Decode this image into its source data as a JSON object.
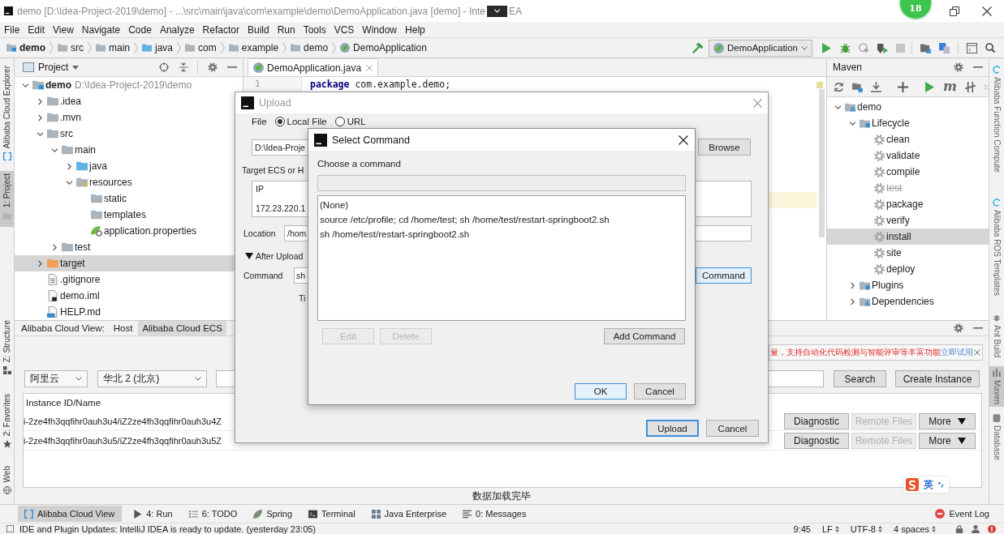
{
  "window": {
    "title": "demo [D:\\Idea-Project-2019\\demo] - ...\\src\\main\\java\\com\\example\\demo\\DemoApplication.java [demo] - Inte",
    "overlay_expanded": false,
    "title_tail": "EA",
    "floating_badge": "18"
  },
  "menu": [
    "File",
    "Edit",
    "View",
    "Navigate",
    "Code",
    "Analyze",
    "Refactor",
    "Build",
    "Run",
    "Tools",
    "VCS",
    "Window",
    "Help"
  ],
  "breadcrumbs": [
    {
      "label": "demo",
      "kind": "module"
    },
    {
      "label": "src",
      "kind": "folder"
    },
    {
      "label": "main",
      "kind": "folder"
    },
    {
      "label": "java",
      "kind": "source"
    },
    {
      "label": "com",
      "kind": "package"
    },
    {
      "label": "example",
      "kind": "package"
    },
    {
      "label": "demo",
      "kind": "package"
    },
    {
      "label": "DemoApplication",
      "kind": "spring"
    }
  ],
  "run_configuration": "DemoApplication",
  "left_strip": [
    {
      "label": "Alibaba Cloud Explorer",
      "kind": "cloud",
      "selected": false
    },
    {
      "label": "1: Project",
      "kind": "folder",
      "selected": true
    },
    {
      "label": "Z: Structure",
      "kind": "structure",
      "selected": false
    },
    {
      "label": "2: Favorites",
      "kind": "star",
      "selected": false
    },
    {
      "label": "Web",
      "kind": "globe",
      "selected": false
    }
  ],
  "project_panel": {
    "title": "Project",
    "tree": [
      {
        "name": "demo",
        "path": "D:\\Idea-Project-2019\\demo",
        "kind": "module",
        "expanded": true,
        "selected": false,
        "children": [
          {
            "name": ".idea",
            "kind": "folder",
            "expanded": false,
            "selected": false
          },
          {
            "name": ".mvn",
            "kind": "folder",
            "expanded": false,
            "selected": false
          },
          {
            "name": "src",
            "kind": "folder",
            "expanded": true,
            "selected": false,
            "children": [
              {
                "name": "main",
                "kind": "folder",
                "expanded": true,
                "selected": false,
                "children": [
                  {
                    "name": "java",
                    "kind": "source",
                    "expanded": false,
                    "selected": false
                  },
                  {
                    "name": "resources",
                    "kind": "resources",
                    "expanded": true,
                    "selected": false,
                    "children": [
                      {
                        "name": "static",
                        "kind": "folder",
                        "selected": false
                      },
                      {
                        "name": "templates",
                        "kind": "folder",
                        "selected": false
                      },
                      {
                        "name": "application.properties",
                        "kind": "properties",
                        "selected": false
                      }
                    ]
                  }
                ]
              },
              {
                "name": "test",
                "kind": "folder",
                "expanded": false,
                "selected": false
              }
            ]
          },
          {
            "name": "target",
            "kind": "excluded",
            "expanded": false,
            "selected": true
          },
          {
            "name": ".gitignore",
            "kind": "text",
            "selected": false
          },
          {
            "name": "demo.iml",
            "kind": "iml",
            "selected": false
          },
          {
            "name": "HELP.md",
            "kind": "markdown",
            "selected": false
          }
        ]
      }
    ]
  },
  "editor": {
    "tabs": [
      {
        "label": "DemoApplication.java",
        "selected": true
      }
    ],
    "lines": [
      {
        "number": "1",
        "code": "**package** com.example.demo;"
      }
    ]
  },
  "maven": {
    "title": "Maven",
    "goal_button": "m",
    "tree": [
      {
        "name": "demo",
        "kind": "project",
        "expanded": true,
        "selected": false,
        "children": [
          {
            "name": "Lifecycle",
            "kind": "lifecycle",
            "expanded": true,
            "selected": false,
            "children": [
              {
                "name": "clean",
                "kind": "goal",
                "skipped": false,
                "selected": false
              },
              {
                "name": "validate",
                "kind": "goal",
                "skipped": false,
                "selected": false
              },
              {
                "name": "compile",
                "kind": "goal",
                "skipped": false,
                "selected": false
              },
              {
                "name": "test",
                "kind": "goal",
                "skipped": true,
                "selected": false
              },
              {
                "name": "package",
                "kind": "goal",
                "skipped": false,
                "selected": false
              },
              {
                "name": "verify",
                "kind": "goal",
                "skipped": false,
                "selected": false
              },
              {
                "name": "install",
                "kind": "goal",
                "skipped": false,
                "selected": true
              },
              {
                "name": "site",
                "kind": "goal",
                "skipped": false,
                "selected": false
              },
              {
                "name": "deploy",
                "kind": "goal",
                "skipped": false,
                "selected": false
              }
            ]
          },
          {
            "name": "Plugins",
            "kind": "plugins",
            "expanded": false,
            "selected": false
          },
          {
            "name": "Dependencies",
            "kind": "dependencies",
            "expanded": false,
            "selected": false
          }
        ]
      }
    ]
  },
  "right_strip": [
    {
      "label": "Alibaba Function Compute",
      "kind": "function",
      "selected": false
    },
    {
      "label": "Alibaba ROS Templates",
      "kind": "ros",
      "selected": false
    },
    {
      "label": "Ant Build",
      "kind": "ant",
      "selected": false
    },
    {
      "label": "Maven",
      "kind": "maven",
      "selected": true
    },
    {
      "label": "Database",
      "kind": "database",
      "selected": false
    }
  ],
  "bottom_panel": {
    "label": "Alibaba Cloud View:",
    "tabs": [
      {
        "label": "Host",
        "selected": false
      },
      {
        "label": "Alibaba Cloud ECS",
        "selected": true
      }
    ],
    "notice": {
      "text": "量，支持自动化代码检测与智能评审等丰富功能",
      "link": "立即试用"
    },
    "account": "阿里云",
    "region": "华北 2 (北京)",
    "search_button": "Search",
    "create_button": "Create Instance",
    "table": {
      "columns": [
        "Instance ID/Name"
      ],
      "rows": [
        {
          "name": "i-2ze4fh3qqfihr0auh3u4/iZ2ze4fh3qqfihr0auh3u4Z",
          "actions": [
            {
              "label": "Diagnostic",
              "disabled": false
            },
            {
              "label": "Remote Files",
              "disabled": true
            },
            {
              "label": "More",
              "disabled": false
            }
          ]
        },
        {
          "name": "i-2ze4fh3qqfihr0auh3u5/iZ2ze4fh3qqfihr0auh3u5Z",
          "actions": [
            {
              "label": "Diagnostic",
              "disabled": false
            },
            {
              "label": "Remote Files",
              "disabled": true
            },
            {
              "label": "More",
              "disabled": false
            }
          ]
        }
      ]
    },
    "status": "数据加载完毕"
  },
  "tool_windows": [
    {
      "label": "Alibaba Cloud View",
      "kind": "cloud",
      "selected": true
    },
    {
      "label": "4: Run",
      "kind": "run",
      "selected": false
    },
    {
      "label": "6: TODO",
      "kind": "todo",
      "selected": false
    },
    {
      "label": "Spring",
      "kind": "leaf",
      "selected": false
    },
    {
      "label": "Terminal",
      "kind": "terminal",
      "selected": false
    },
    {
      "label": "Java Enterprise",
      "kind": "enterprise",
      "selected": false
    },
    {
      "label": "0: Messages",
      "kind": "messages",
      "selected": false
    }
  ],
  "event_log": "Event Log",
  "status_bar": {
    "message": "IDE and Plugin Updates: IntelliJ IDEA is ready to update. (yesterday 23:05)",
    "position": "9:45",
    "line_separator": "LF",
    "encoding": "UTF-8",
    "indent": "4 spaces"
  },
  "upload_dialog": {
    "title": "Upload",
    "file_label": "File",
    "sources": [
      {
        "label": "Local File",
        "selected": true
      },
      {
        "label": "URL",
        "selected": false
      }
    ],
    "file_path": "D:\\Idea-Proje",
    "browse_button": "Browse",
    "target_label": "Target ECS or H",
    "target_table": {
      "column": "IP",
      "row": "172.23.220.1"
    },
    "location_label": "Location",
    "location": "/hom",
    "after_upload": {
      "label": "After Upload",
      "expanded": true
    },
    "command_label": "Command",
    "command": "sh",
    "command_button": {
      "label": "Command",
      "focused": true
    },
    "tip": "Ti",
    "buttons": [
      {
        "label": "Upload",
        "default": true
      },
      {
        "label": "Cancel",
        "default": false
      }
    ]
  },
  "select_command_dialog": {
    "title": "Select Command",
    "prompt": "Choose a command",
    "commands": [
      {
        "text": "(None)",
        "selected": false
      },
      {
        "text": "source /etc/profile; cd /home/test; sh /home/test/restart-springboot2.sh",
        "selected": false
      },
      {
        "text": "sh /home/test/restart-springboot2.sh",
        "selected": false
      }
    ],
    "buttons": [
      {
        "label": "Edit",
        "disabled": true
      },
      {
        "label": "Delete",
        "disabled": true
      },
      {
        "label": "Add Command",
        "disabled": false
      }
    ],
    "footer_buttons": [
      {
        "label": "OK",
        "default": true
      },
      {
        "label": "Cancel",
        "default": false
      }
    ]
  },
  "ime": {
    "mode": "英"
  }
}
